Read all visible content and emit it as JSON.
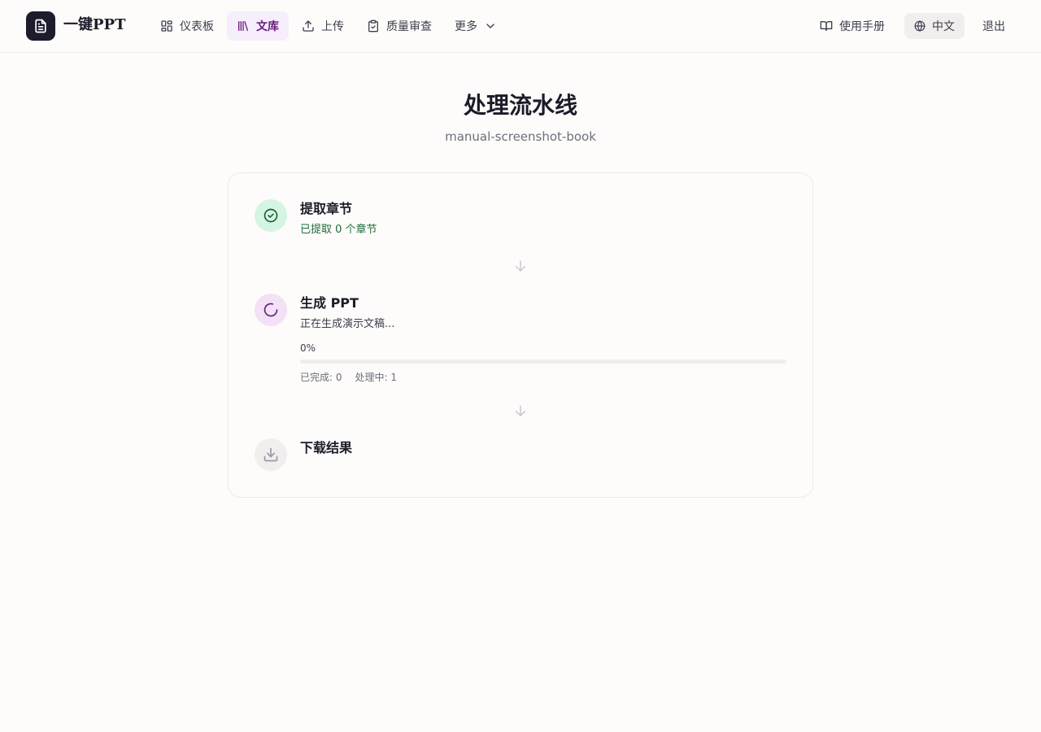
{
  "app": {
    "name": "一键PPT"
  },
  "nav": {
    "items": [
      {
        "label": "仪表板",
        "icon": "dashboard-icon"
      },
      {
        "label": "文库",
        "icon": "library-icon",
        "active": true
      },
      {
        "label": "上传",
        "icon": "upload-icon"
      },
      {
        "label": "质量审查",
        "icon": "clipboard-check-icon"
      },
      {
        "label": "更多",
        "icon": "chevron-down-icon"
      }
    ]
  },
  "header_right": {
    "manual": "使用手册",
    "language": "中文",
    "logout": "退出"
  },
  "page": {
    "title": "处理流水线",
    "subtitle": "manual-screenshot-book"
  },
  "steps": [
    {
      "title": "提取章节",
      "desc": "已提取 0 个章节",
      "status": "done"
    },
    {
      "title": "生成 PPT",
      "desc": "正在生成演示文稿...",
      "status": "in-progress",
      "progress_text": "0%",
      "progress_value": 0,
      "completed": "已完成: 0",
      "processing": "处理中: 1"
    },
    {
      "title": "下载结果",
      "status": "pending"
    }
  ],
  "colors": {
    "accent": "#6b1f82",
    "success": "#1f6b3a",
    "success_bg": "#d4f5e2",
    "progress_bg": "#f3e1f5"
  }
}
